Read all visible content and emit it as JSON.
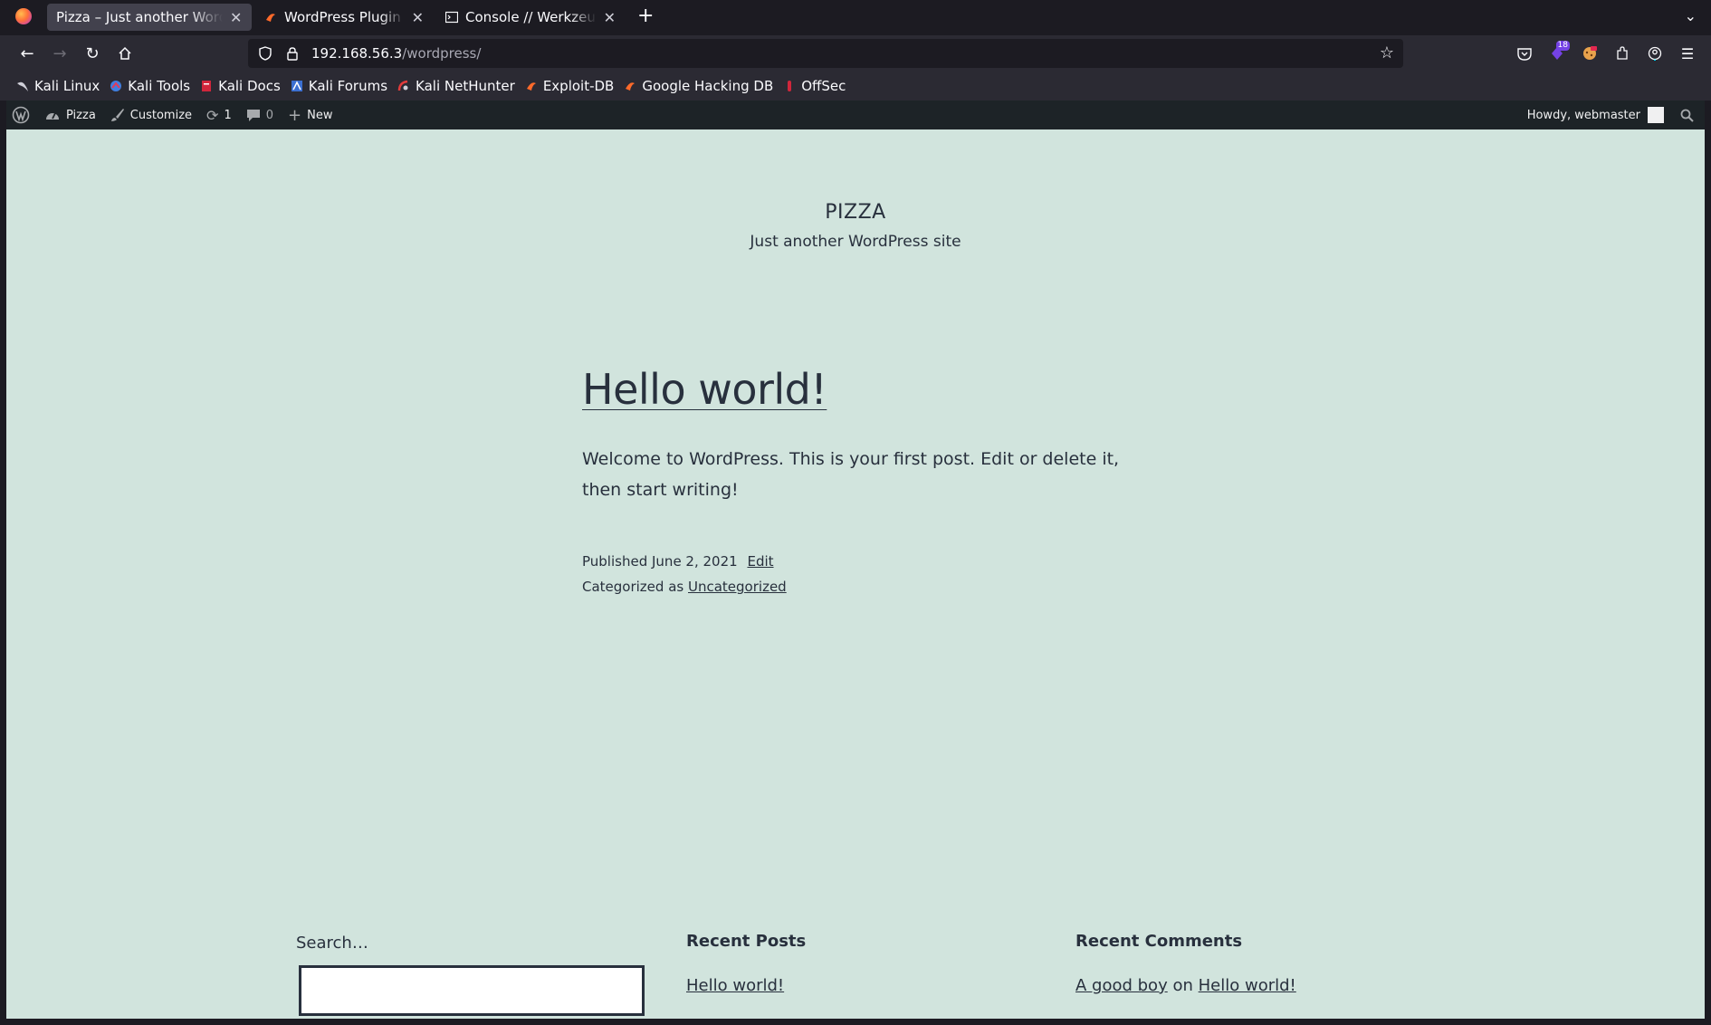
{
  "browser": {
    "tabs": [
      {
        "title": "Pizza – Just another WordPre",
        "active": true
      },
      {
        "title": "WordPress Plugin cp-mul",
        "active": false
      },
      {
        "title": "Console // Werkzeug Deb",
        "active": false
      }
    ],
    "url_host": "192.168.56.3",
    "url_path": "/wordpress/",
    "extension_badge": "18",
    "bookmarks": [
      "Kali Linux",
      "Kali Tools",
      "Kali Docs",
      "Kali Forums",
      "Kali NetHunter",
      "Exploit-DB",
      "Google Hacking DB",
      "OffSec"
    ]
  },
  "adminbar": {
    "site_name": "Pizza",
    "customize": "Customize",
    "updates_count": "1",
    "comments_count": "0",
    "new": "New",
    "howdy": "Howdy, webmaster"
  },
  "site": {
    "title": "PIZZA",
    "description": "Just another WordPress site"
  },
  "post": {
    "title": "Hello world!",
    "content": "Welcome to WordPress. This is your first post. Edit or delete it, then start writing!",
    "published_prefix": "Published",
    "published_date": "June 2, 2021",
    "edit": "Edit",
    "categorized_prefix": "Categorized as",
    "category": "Uncategorized"
  },
  "widgets": {
    "search_label": "Search…",
    "recent_posts_title": "Recent Posts",
    "recent_posts": [
      "Hello world!"
    ],
    "recent_comments_title": "Recent Comments",
    "comment_author": "A good boy",
    "comment_on": "on",
    "comment_post": "Hello world!"
  },
  "colors": {
    "page_bg": "#d1e4dd",
    "text": "#28303d",
    "adminbar_bg": "#1d2327",
    "chrome_bg": "#1c1b22",
    "toolbar_bg": "#2b2a33"
  }
}
